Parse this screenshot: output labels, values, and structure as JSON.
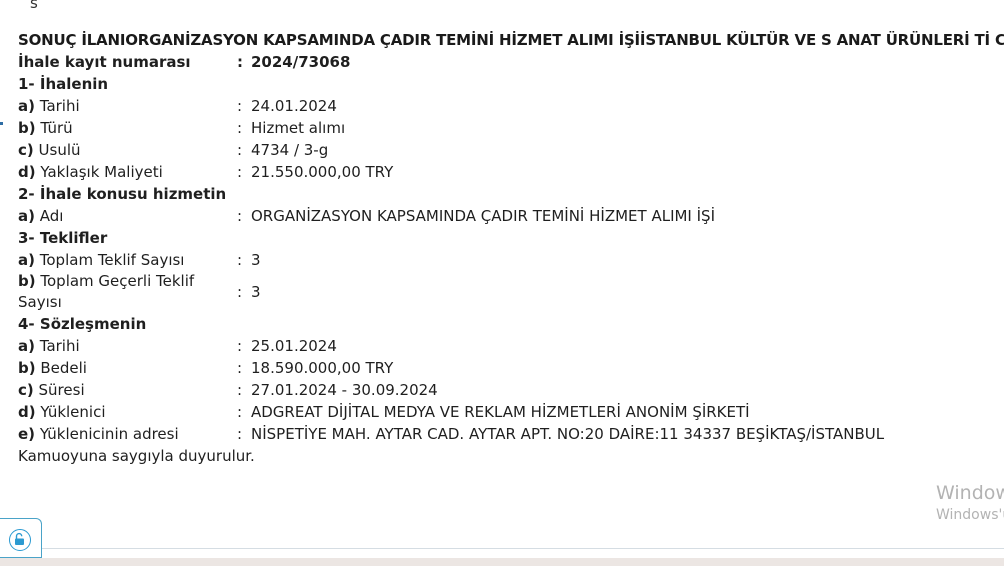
{
  "top_fragment": "s",
  "title": "SONUÇ İLANIORGANİZASYON KAPSAMINDA ÇADIR TEMİNİ HİZMET ALIMI İŞİİSTANBUL KÜLTÜR VE S ANAT ÜRÜNLERİ Tİ C.A.Ş.",
  "colon": ":",
  "registration": {
    "label": "İhale kayıt numarası",
    "value": "2024/73068"
  },
  "section1": {
    "heading": "1- İhalenin",
    "rows": [
      {
        "letter": "a)",
        "label": "Tarihi",
        "value": "24.01.2024"
      },
      {
        "letter": "b)",
        "label": "Türü",
        "value": "Hizmet alımı"
      },
      {
        "letter": "c)",
        "label": "Usulü",
        "value": "4734 / 3-g"
      },
      {
        "letter": "d)",
        "label": "Yaklaşık Maliyeti",
        "value": "21.550.000,00 TRY"
      }
    ]
  },
  "section2": {
    "heading": "2- İhale konusu hizmetin",
    "rows": [
      {
        "letter": "a)",
        "label": "Adı",
        "value": "ORGANİZASYON KAPSAMINDA ÇADIR TEMİNİ HİZMET ALIMI İŞİ"
      }
    ]
  },
  "section3": {
    "heading": "3- Teklifler",
    "rows": [
      {
        "letter": "a)",
        "label": "Toplam Teklif Sayısı",
        "value": "3"
      },
      {
        "letter": "b)",
        "label_line1": "Toplam Geçerli Teklif",
        "label_line2": "Sayısı",
        "value": "3"
      }
    ]
  },
  "section4": {
    "heading": "4- Sözleşmenin",
    "rows": [
      {
        "letter": "a)",
        "label": "Tarihi",
        "value": "25.01.2024"
      },
      {
        "letter": "b)",
        "label": "Bedeli",
        "value": "18.590.000,00 TRY"
      },
      {
        "letter": "c)",
        "label": "Süresi",
        "value": "27.01.2024 - 30.09.2024"
      },
      {
        "letter": "d)",
        "label": "Yüklenici",
        "value": "ADGREAT DİJİTAL MEDYA VE REKLAM HİZMETLERİ ANONİM ŞİRKETİ"
      },
      {
        "letter": "e)",
        "label": "Yüklenicinin adresi",
        "value": "NİSPETİYE MAH. AYTAR CAD. AYTAR APT. NO:20 DAİRE:11 34337 BEŞİKTAŞ/İSTANBUL"
      }
    ]
  },
  "closing": "Kamuoyuna saygıyla duyurulur.",
  "watermark": {
    "line1": "Window",
    "line2": "Windows'u"
  },
  "icons": {
    "lock_button": "unlock-icon"
  },
  "colors": {
    "text": "#1f1f1f",
    "accent": "#2b9ad1",
    "watermark": "#b3b3b3"
  }
}
